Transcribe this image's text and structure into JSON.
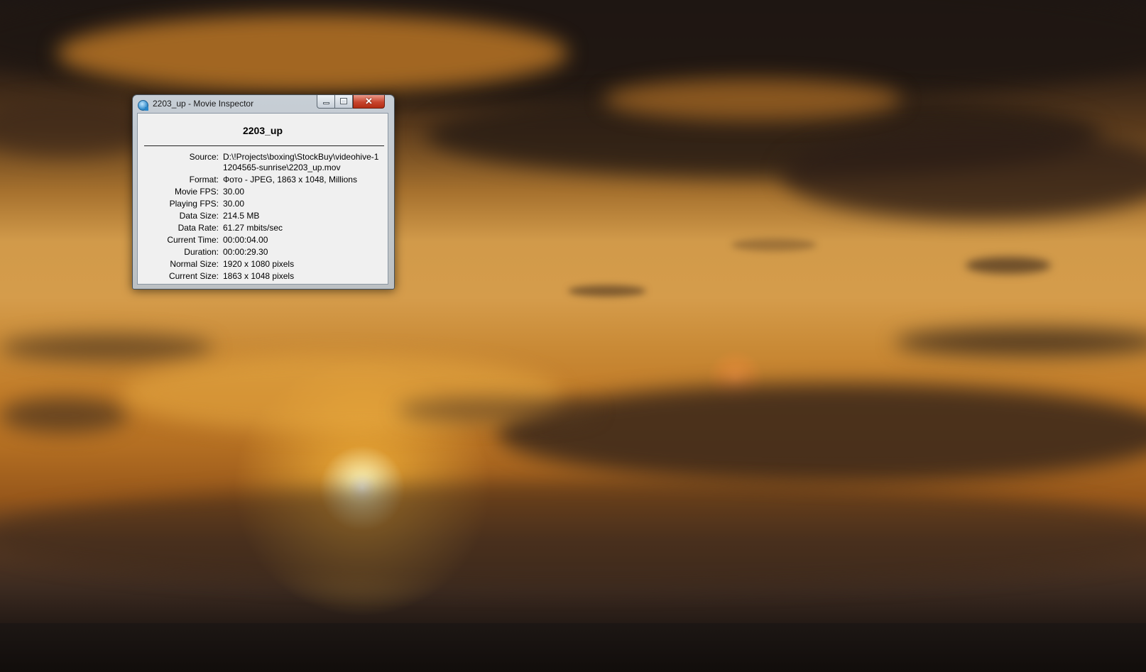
{
  "window": {
    "title": "2203_up - Movie Inspector",
    "minimize_glyph": "minimize-icon",
    "maximize_glyph": "maximize-icon",
    "close_glyph": "✕"
  },
  "movie": {
    "name": "2203_up",
    "fields": [
      {
        "label": "Source:",
        "value": "D:\\!Projects\\boxing\\StockBuy\\videohive-11204565-sunrise\\2203_up.mov"
      },
      {
        "label": "Format:",
        "value": "Фото - JPEG, 1863 x 1048, Millions"
      },
      {
        "label": "Movie FPS:",
        "value": "30.00"
      },
      {
        "label": "Playing FPS:",
        "value": "30.00"
      },
      {
        "label": "Data Size:",
        "value": "214.5 MB"
      },
      {
        "label": "Data Rate:",
        "value": "61.27 mbits/sec"
      },
      {
        "label": "Current Time:",
        "value": "00:00:04.00"
      },
      {
        "label": "Duration:",
        "value": "00:00:29.30"
      },
      {
        "label": "Normal Size:",
        "value": "1920 x 1080 pixels"
      },
      {
        "label": "Current Size:",
        "value": "1863 x 1048 pixels"
      }
    ]
  },
  "colors": {
    "close_button": "#c8452e",
    "client_background": "#f0f0f0"
  }
}
